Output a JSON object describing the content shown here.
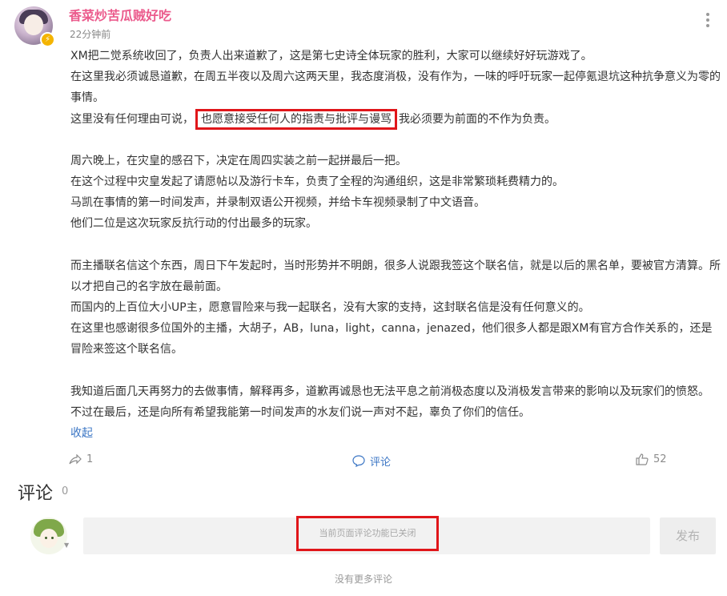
{
  "post": {
    "username": "香菜炒苦瓜贼好吃",
    "time": "22分钟前",
    "paragraphs": [
      "XM把二觉系统收回了，负责人出来道歉了，这是第七史诗全体玩家的胜利，大家可以继续好好玩游戏了。",
      "在这里我必须诚恳道歉，在周五半夜以及周六这两天里，我态度消极，没有作为，一味的呼吁玩家一起停氪退坑这种抗争意义为零的事情。",
      "周六晚上，在灾皇的感召下，决定在周四实装之前一起拼最后一把。",
      "在这个过程中灾皇发起了请愿帖以及游行卡车，负责了全程的沟通组织，这是非常繁琐耗费精力的。",
      "马凯在事情的第一时间发声，并录制双语公开视频，并给卡车视频录制了中文语音。",
      "他们二位是这次玩家反抗行动的付出最多的玩家。",
      "而主播联名信这个东西，周日下午发起时，当时形势并不明朗，很多人说跟我签这个联名信，就是以后的黑名单，要被官方清算。所以才把自己的名字放在最前面。",
      "而国内的上百位大小UP主，愿意冒险来与我一起联名，没有大家的支持，这封联名信是没有任何意义的。",
      "在这里也感谢很多位国外的主播，大胡子，AB，luna，light，canna，jenazed，他们很多人都是跟XM有官方合作关系的，还是冒险来签这个联名信。",
      "我知道后面几天再努力的去做事情，解释再多，道歉再诚恳也无法平息之前消极态度以及消极发言带来的影响以及玩家们的愤怒。",
      "不过在最后，还是向所有希望我能第一时间发声的水友们说一声对不起，辜负了你们的信任。"
    ],
    "line3_before": "这里没有任何理由可说，",
    "line3_highlight": "也愿意接受任何人的指责与批评与谩骂",
    "line3_after": "我必须要为前面的不作为负责。",
    "collapse_label": "收起",
    "share_count": "1",
    "comment_label": "评论",
    "like_count": "52"
  },
  "comments": {
    "title": "评论",
    "count": "0",
    "input_placeholder": "当前页面评论功能已关闭",
    "submit_label": "发布",
    "no_more": "没有更多评论"
  },
  "colors": {
    "username": "#eb5a8c",
    "link": "#3a75c4",
    "highlight_border": "#e0161a",
    "badge": "#f4b400"
  },
  "icons": [
    "more-vertical-icon",
    "verified-badge-icon",
    "share-icon",
    "comment-icon",
    "like-icon",
    "chevron-down-icon"
  ]
}
